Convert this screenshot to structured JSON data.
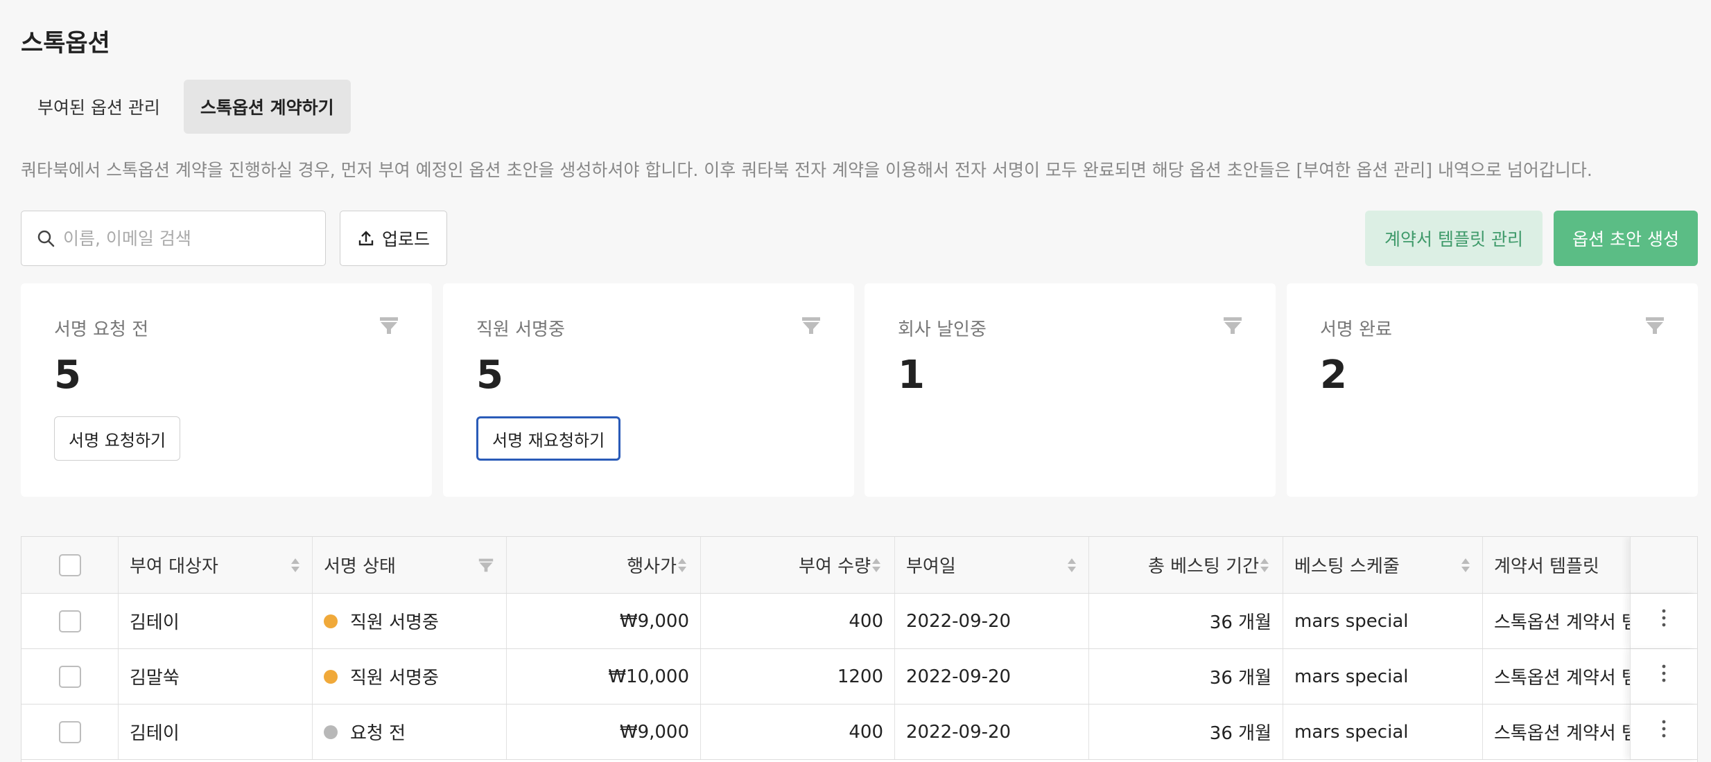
{
  "page": {
    "title": "스톡옵션"
  },
  "tabs": [
    {
      "label": "부여된 옵션 관리",
      "active": false
    },
    {
      "label": "스톡옵션 계약하기",
      "active": true
    }
  ],
  "description": "쿼타북에서 스톡옵션 계약을 진행하실 경우, 먼저 부여 예정인 옵션 초안을 생성하셔야 합니다. 이후 쿼타북 전자 계약을 이용해서 전자 서명이 모두 완료되면 해당 옵션 초안들은 [부여한 옵션 관리] 내역으로 넘어갑니다.",
  "toolbar": {
    "search_placeholder": "이름, 이메일 검색",
    "upload_label": "업로드",
    "template_label": "계약서 템플릿 관리",
    "create_label": "옵션 초안 생성"
  },
  "cards": [
    {
      "label": "서명 요청 전",
      "count": "5",
      "button": "서명 요청하기"
    },
    {
      "label": "직원 서명중",
      "count": "5",
      "button": "서명 재요청하기"
    },
    {
      "label": "회사 날인중",
      "count": "1",
      "button": ""
    },
    {
      "label": "서명 완료",
      "count": "2",
      "button": ""
    }
  ],
  "table": {
    "headers": {
      "grantee": "부여 대상자",
      "status": "서명 상태",
      "price": "행사가",
      "quantity": "부여 수량",
      "grant_date": "부여일",
      "vesting_period": "총 베스팅 기간",
      "vesting_schedule": "베스팅 스케줄",
      "template": "계약서 템플릿"
    },
    "rows": [
      {
        "grantee": "김테이",
        "status": "직원 서명중",
        "status_color": "#f0a93a",
        "price": "₩9,000",
        "quantity": "400",
        "grant_date": "2022-09-20",
        "vesting_period": "36 개월",
        "vesting_schedule": "mars special",
        "template": "스톡옵션 계약서 템"
      },
      {
        "grantee": "김말쑥",
        "status": "직원 서명중",
        "status_color": "#f0a93a",
        "price": "₩10,000",
        "quantity": "1200",
        "grant_date": "2022-09-20",
        "vesting_period": "36 개월",
        "vesting_schedule": "mars special",
        "template": "스톡옵션 계약서 템"
      },
      {
        "grantee": "김테이",
        "status": "요청 전",
        "status_color": "#b8b8b8",
        "price": "₩9,000",
        "quantity": "400",
        "grant_date": "2022-09-20",
        "vesting_period": "36 개월",
        "vesting_schedule": "mars special",
        "template": "스톡옵션 계약서 템"
      }
    ]
  },
  "colors": {
    "accent_green": "#5bbd85",
    "light_green": "#dcefe4",
    "focus_blue": "#2a5bb8",
    "status_signing": "#f0a93a",
    "status_pending": "#b8b8b8"
  }
}
